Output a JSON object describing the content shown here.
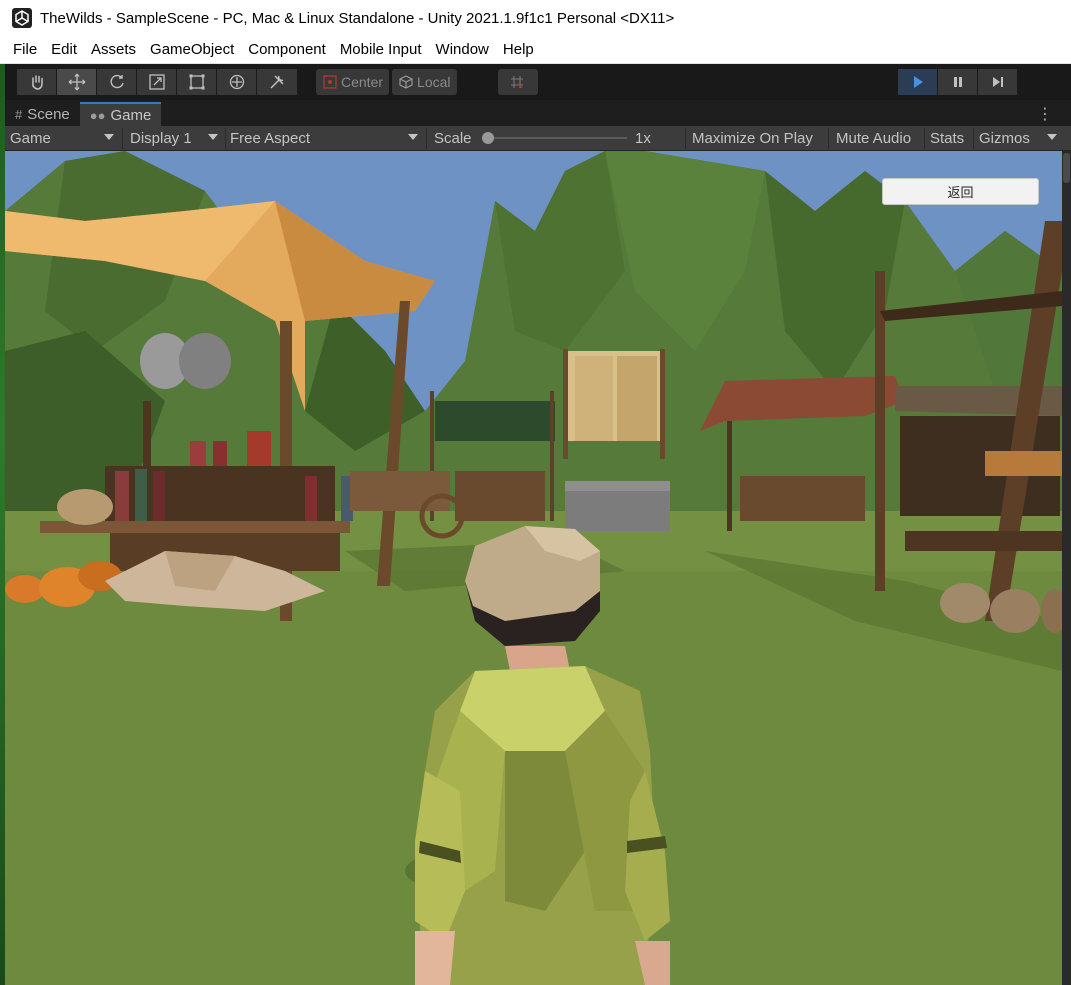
{
  "window": {
    "title": "TheWilds - SampleScene - PC, Mac & Linux Standalone - Unity 2021.1.9f1c1 Personal <DX11>",
    "icon": "unity-logo-icon"
  },
  "menubar": {
    "items": [
      "File",
      "Edit",
      "Assets",
      "GameObject",
      "Component",
      "Mobile Input",
      "Window",
      "Help"
    ]
  },
  "toolbar": {
    "tools": [
      "hand-tool-icon",
      "move-tool-icon",
      "rotate-tool-icon",
      "scale-tool-icon",
      "rect-tool-icon",
      "transform-tool-icon",
      "custom-tools-icon"
    ],
    "pivot_label": "Center",
    "space_label": "Local",
    "play_controls": [
      "play-icon",
      "pause-icon",
      "step-icon"
    ]
  },
  "tabs": {
    "scene_label": "Scene",
    "game_label": "Game"
  },
  "gamebar": {
    "mode_label": "Game",
    "display_label": "Display 1",
    "aspect_label": "Free Aspect",
    "scale_label": "Scale",
    "scale_value": "1x",
    "maximize_label": "Maximize On Play",
    "mute_label": "Mute Audio",
    "stats_label": "Stats",
    "gizmos_label": "Gizmos"
  },
  "game_ui": {
    "back_button_label": "返回"
  },
  "colors": {
    "play_active": "#2a3d55",
    "accent_tab": "#3a79bb",
    "sky": "#6f92c4",
    "grass": "#6e8a3e",
    "mountains": "#4d6e35"
  }
}
